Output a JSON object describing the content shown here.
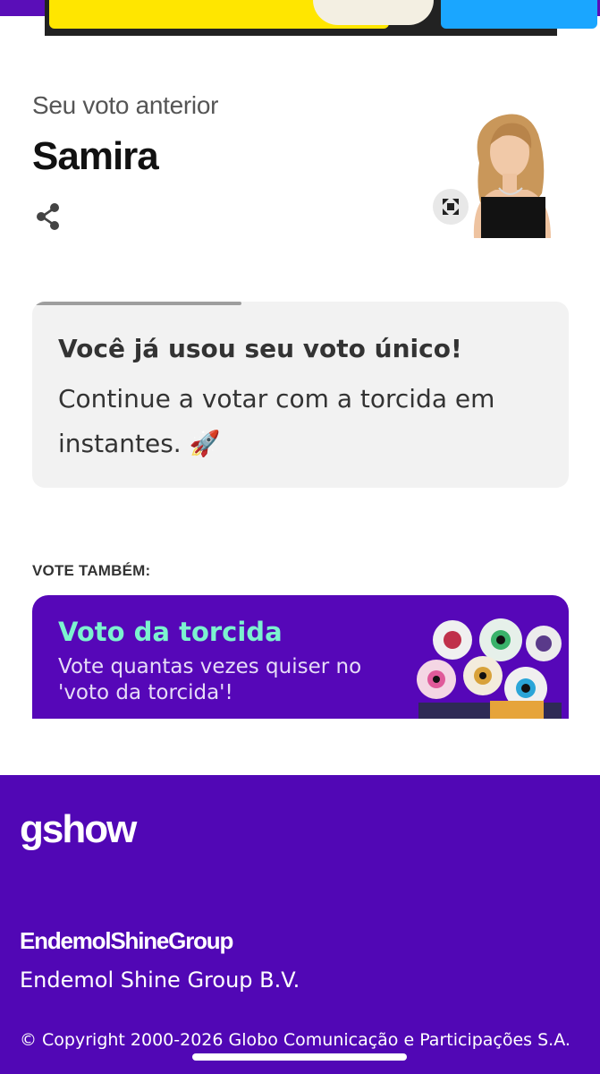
{
  "previous_vote": {
    "label": "Seu voto anterior",
    "name": "Samira"
  },
  "icons": {
    "share": "share-icon",
    "expand": "expand-icon",
    "rocket": "rocket-emoji"
  },
  "notice": {
    "title": "Você já usou seu voto único!",
    "body": "Continue a votar com a torcida em instantes. 🚀",
    "progress": 0.39
  },
  "vote_also": {
    "label": "VOTE TAMBÉM:",
    "card": {
      "title": "Voto da torcida",
      "subtitle": "Vote quantas vezes quiser no 'voto da torcida'!"
    }
  },
  "footer": {
    "logo": "gshow",
    "partner_logo": "EndemolShineGroup",
    "company": "Endemol Shine Group B.V.",
    "copyright": "© Copyright 2000-2026 Globo Comunicação e Participações S.A."
  },
  "colors": {
    "brand_purple": "#5107b5",
    "card_purple": "#5607b8",
    "mint": "#7cf2cf",
    "notice_bg": "#f2f2f2"
  }
}
